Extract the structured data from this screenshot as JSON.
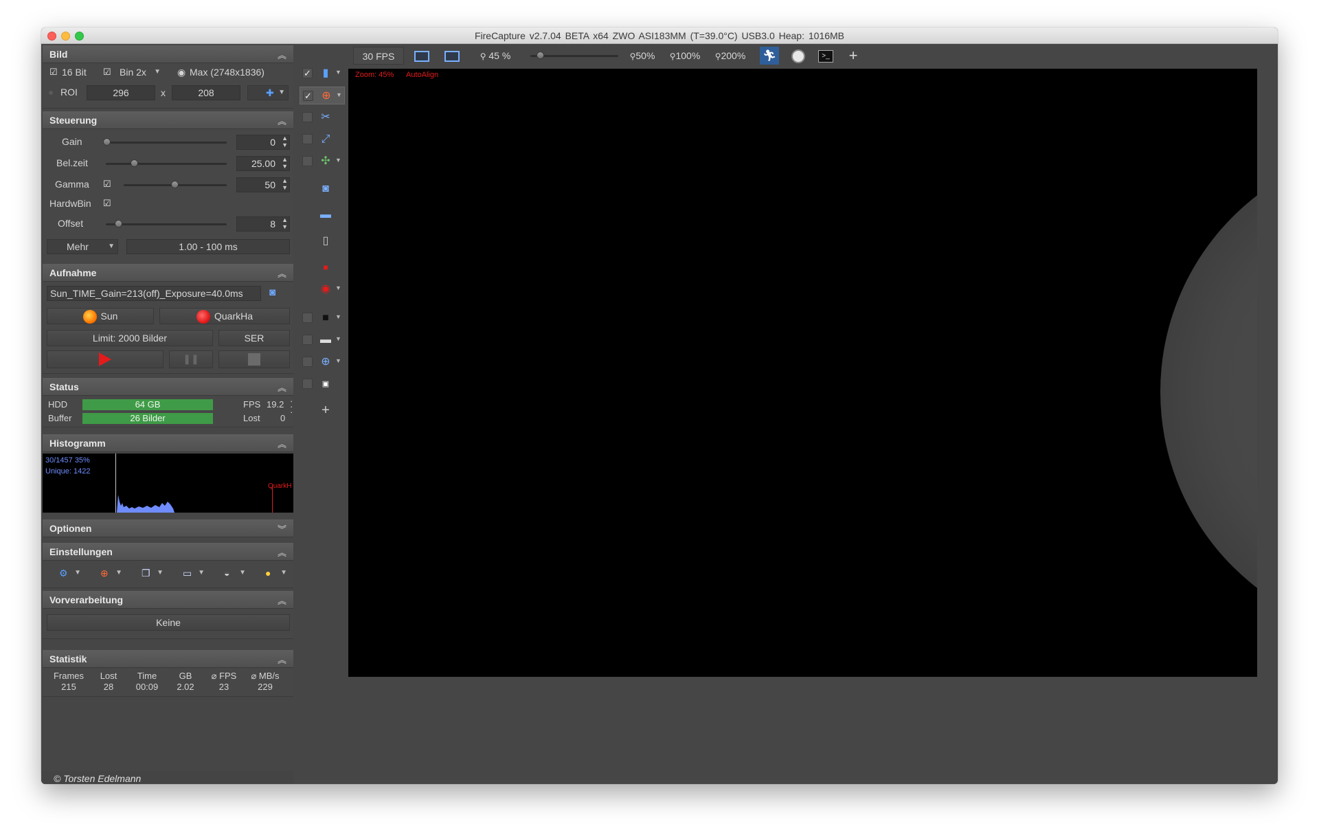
{
  "window": {
    "title": "FireCapture v2.7.04 BETA x64     ZWO ASI183MM (T=39.0°C) USB3.0     Heap: 1016MB"
  },
  "bild": {
    "header": "Bild",
    "bit_label": "16 Bit",
    "bin_value": "Bin 2x",
    "max_label": "Max (2748x1836)",
    "roi_label": "ROI",
    "roi_w": "296",
    "roi_x": "x",
    "roi_h": "208"
  },
  "steuerung": {
    "header": "Steuerung",
    "gain_label": "Gain",
    "gain_value": "0",
    "gain_level": 0,
    "belzeit_label": "Bel.zeit",
    "belzeit_value": "25.00",
    "belzeit_level": 0.22,
    "gamma_label": "Gamma",
    "gamma_value": "50",
    "gamma_level": 0.5,
    "hardwbin_label": "HardwBin",
    "offset_label": "Offset",
    "offset_value": "8",
    "offset_level": 0.08,
    "mehr_label": "Mehr",
    "range_label": "1.00 - 100 ms"
  },
  "aufnahme": {
    "header": "Aufnahme",
    "filename": "Sun_TIME_Gain=213(off)_Exposure=40.0ms",
    "sun_label": "Sun",
    "quarkha_label": "QuarkHa",
    "limit_label": "Limit: 2000 Bilder",
    "format_label": "SER"
  },
  "status": {
    "header": "Status",
    "hdd_label": "HDD",
    "hdd_value": "64 GB",
    "fps_label": "FPS",
    "fps_value": "19.2",
    "buffer_label": "Buffer",
    "buffer_value": "26  Bilder",
    "lost_label": "Lost",
    "lost_value": "0"
  },
  "histogramm": {
    "header": "Histogramm",
    "line1": "30/1457 35%",
    "line2": "Unique: 1422",
    "marker_label": "QuarkH"
  },
  "optionen": {
    "header": "Optionen"
  },
  "einstellungen": {
    "header": "Einstellungen"
  },
  "vorverarbeitung": {
    "header": "Vorverarbeitung",
    "value": "Keine"
  },
  "statistik": {
    "header": "Statistik",
    "columns": [
      {
        "h": "Frames",
        "v": "215"
      },
      {
        "h": "Lost",
        "v": "28"
      },
      {
        "h": "Time",
        "v": "00:09"
      },
      {
        "h": "GB",
        "v": "2.02"
      },
      {
        "h": "⌀ FPS",
        "v": "23"
      },
      {
        "h": "⌀ MB/s",
        "v": "229"
      }
    ]
  },
  "footer": {
    "copyright": "© Torsten Edelmann"
  },
  "toolbar": {
    "fps_label": "30 FPS",
    "zoom_value": "45 %",
    "zoom_level": 0.08,
    "zoom50": "50%",
    "zoom100": "100%",
    "zoom200": "200%",
    "plus": "+"
  },
  "preview": {
    "zoom_text": "Zoom: 45%",
    "autoalign_text": "AutoAlign"
  },
  "colors": {
    "accent_red": "#e41b1b",
    "status_green": "#3f9b47",
    "histogram_blue": "#6f8cff"
  }
}
